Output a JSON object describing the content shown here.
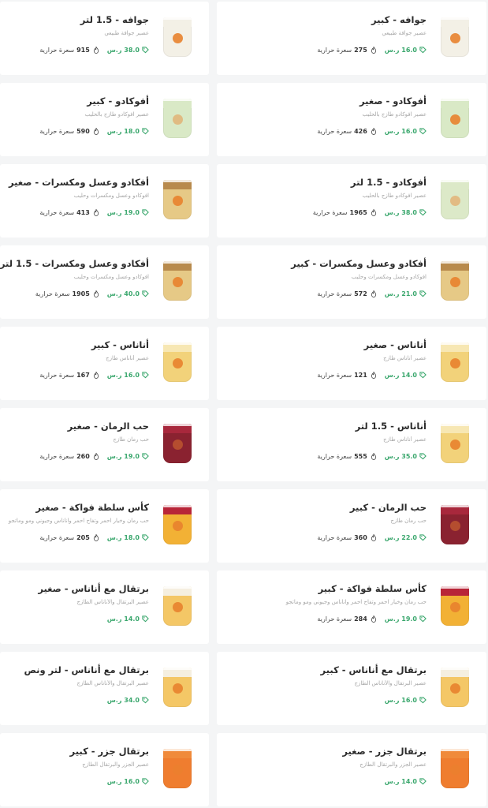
{
  "labels": {
    "currency": "ر.س",
    "calories": "سعرة حرارية"
  },
  "colors": {
    "price": "#3aa76d",
    "card": "#ffffff",
    "background": "#f4f5f6"
  },
  "items": [
    {
      "name": "جوافه - كبير",
      "desc": "عصير جوافة طبيعي",
      "price": "16.0",
      "calories": "275",
      "cup": "#f3f0e6",
      "top": "#f3f0e6",
      "logo": true
    },
    {
      "name": "جوافه - 1.5 لتر",
      "desc": "عصير جوافة طبيعي",
      "price": "38.0",
      "calories": "915",
      "cup": "#f3f0e6",
      "top": "#f3f0e6",
      "logo": true
    },
    {
      "name": "أفوكادو - صغير",
      "desc": "عصير افوكادو طازج بالحليب",
      "price": "16.0",
      "calories": "426",
      "cup": "#d9e9c6",
      "top": "#d9e9c6",
      "logo": true
    },
    {
      "name": "أفوكادو - كبير",
      "desc": "عصير افوكادو طازج بالحليب",
      "price": "18.0",
      "calories": "590",
      "cup": "#d9e9c6",
      "top": "#d9e9c6",
      "logo": false
    },
    {
      "name": "أفوكادو - 1.5 لتر",
      "desc": "عصير افوكادو طازج بالحليب",
      "price": "38.0",
      "calories": "1965",
      "cup": "#dce9c8",
      "top": "#dce9c8",
      "logo": false
    },
    {
      "name": "أفكادو وعسل ومكسرات - صغير",
      "desc": "افوكادو وعسل ومكسرات وحليب",
      "price": "19.0",
      "calories": "413",
      "cup": "#e6c986",
      "top": "#b88a4c",
      "logo": true
    },
    {
      "name": "أفكادو وعسل ومكسرات - كبير",
      "desc": "افوكادو وعسل ومكسرات وحليب",
      "price": "21.0",
      "calories": "572",
      "cup": "#e6c986",
      "top": "#b88a4c",
      "logo": true
    },
    {
      "name": "أفكادو وعسل ومكسرات - 1.5 لتر",
      "desc": "افوكادو وعسل ومكسرات وحليب",
      "price": "40.0",
      "calories": "1905",
      "cup": "#e6c986",
      "top": "#b88a4c",
      "logo": true
    },
    {
      "name": "أناناس - صغير",
      "desc": "عصير أناناس طازج",
      "price": "14.0",
      "calories": "121",
      "cup": "#f2d27a",
      "top": "#f7e7b3",
      "logo": true
    },
    {
      "name": "أناناس - كبير",
      "desc": "عصير أناناس طازج",
      "price": "16.0",
      "calories": "167",
      "cup": "#f2d27a",
      "top": "#f7e7b3",
      "logo": true
    },
    {
      "name": "أناناس - 1.5 لتر",
      "desc": "عصير أناناس طازج",
      "price": "35.0",
      "calories": "555",
      "cup": "#f2d27a",
      "top": "#f7e7b3",
      "logo": true
    },
    {
      "name": "حب الرمان - صغير",
      "desc": "حب رمان طازج",
      "price": "19.0",
      "calories": "260",
      "cup": "#8a2230",
      "top": "#a8283c",
      "logo": false
    },
    {
      "name": "حب الرمان - كبير",
      "desc": "حب رمان طازج",
      "price": "22.0",
      "calories": "360",
      "cup": "#8a2230",
      "top": "#a8283c",
      "logo": false
    },
    {
      "name": "كأس سلطة فواكة - صغير",
      "desc": "حب رمان وخيار احمر وتفاح احمر واناناس وجيوني ومو وماتجو",
      "price": "18.0",
      "calories": "205",
      "cup": "#f2b135",
      "top": "#b82538",
      "logo": true
    },
    {
      "name": "كأس سلطة فواكة - كبير",
      "desc": "حب رمان وخيار احمر وتفاح احمر واناناس وجيوني ومو وماتجو",
      "price": "19.0",
      "calories": "284",
      "cup": "#f2b135",
      "top": "#b82538",
      "logo": true
    },
    {
      "name": "برتقال مع أناناس - صغير",
      "desc": "عصير البرتقال والأناناس الطازج",
      "price": "14.0",
      "calories": "",
      "cup": "#f4c766",
      "top": "#f5efe0",
      "logo": true
    },
    {
      "name": "برتقال مع أناناس - كبير",
      "desc": "عصير البرتقال والأناناس الطازج",
      "price": "16.0",
      "calories": "",
      "cup": "#f4c766",
      "top": "#f5efe0",
      "logo": true
    },
    {
      "name": "برتقال مع أناناس - لتر ونص",
      "desc": "عصير البرتقال والأناناس الطازج",
      "price": "34.0",
      "calories": "",
      "cup": "#f4c766",
      "top": "#f5efe0",
      "logo": true
    },
    {
      "name": "برتقال جزر - صغير",
      "desc": "عصير الجزر والبرتقال الطازج",
      "price": "14.0",
      "calories": "",
      "cup": "#ef7d2f",
      "top": "#f08a3a",
      "logo": false
    },
    {
      "name": "برتقال جزر - كبير",
      "desc": "عصير الجزر والبرتقال الطازج",
      "price": "16.0",
      "calories": "",
      "cup": "#ef7d2f",
      "top": "#f08a3a",
      "logo": false
    }
  ]
}
